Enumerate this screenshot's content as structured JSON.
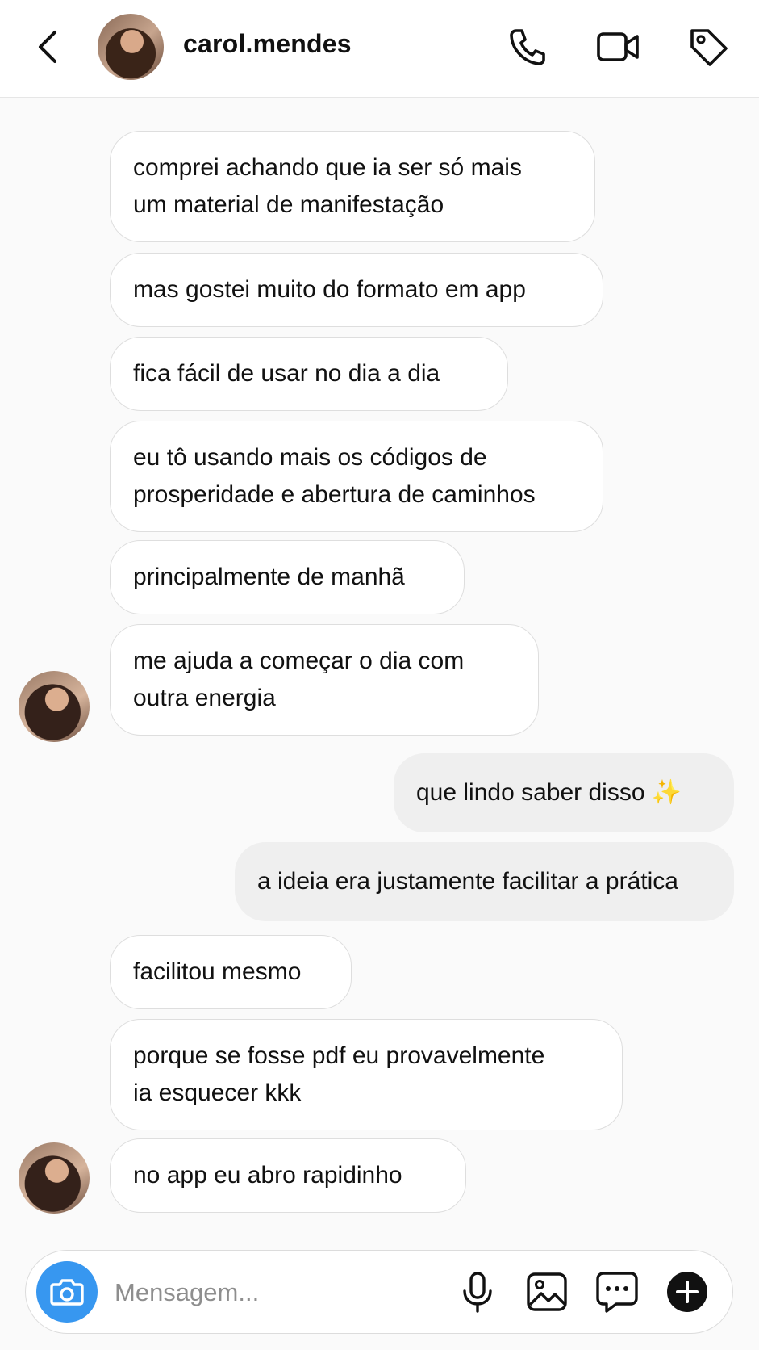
{
  "header": {
    "username": "carol.mendes",
    "icons": [
      "chevron-left-icon",
      "phone-icon",
      "video-camera-icon",
      "tag-icon"
    ]
  },
  "messages": [
    {
      "from": "them",
      "text": "comprei achando que ia ser só mais\num material de manifestação"
    },
    {
      "from": "them",
      "text": "mas gostei muito do formato em app"
    },
    {
      "from": "them",
      "text": "fica fácil de usar no dia a dia"
    },
    {
      "from": "them",
      "text": "eu tô usando mais os códigos de\nprosperidade e abertura de caminhos"
    },
    {
      "from": "them",
      "text": "principalmente de manhã"
    },
    {
      "from": "them",
      "text": "me ajuda a começar o dia com\noutra energia"
    },
    {
      "from": "me",
      "text": "que lindo saber disso ✨"
    },
    {
      "from": "me",
      "text": "a ideia era justamente facilitar a prática"
    },
    {
      "from": "them",
      "text": "facilitou mesmo"
    },
    {
      "from": "them",
      "text": "porque se fosse pdf eu provavelmente\nia esquecer kkk"
    },
    {
      "from": "them",
      "text": "no app eu abro rapidinho"
    }
  ],
  "composer": {
    "placeholder": "Mensagem...",
    "icons": [
      "camera-icon",
      "microphone-icon",
      "image-icon",
      "sticker-icon",
      "plus-circle-icon"
    ]
  },
  "colors": {
    "accent": "#3797f0",
    "incoming_bubble": "#ffffff",
    "outgoing_bubble": "#efefef",
    "background": "#fafafa"
  }
}
